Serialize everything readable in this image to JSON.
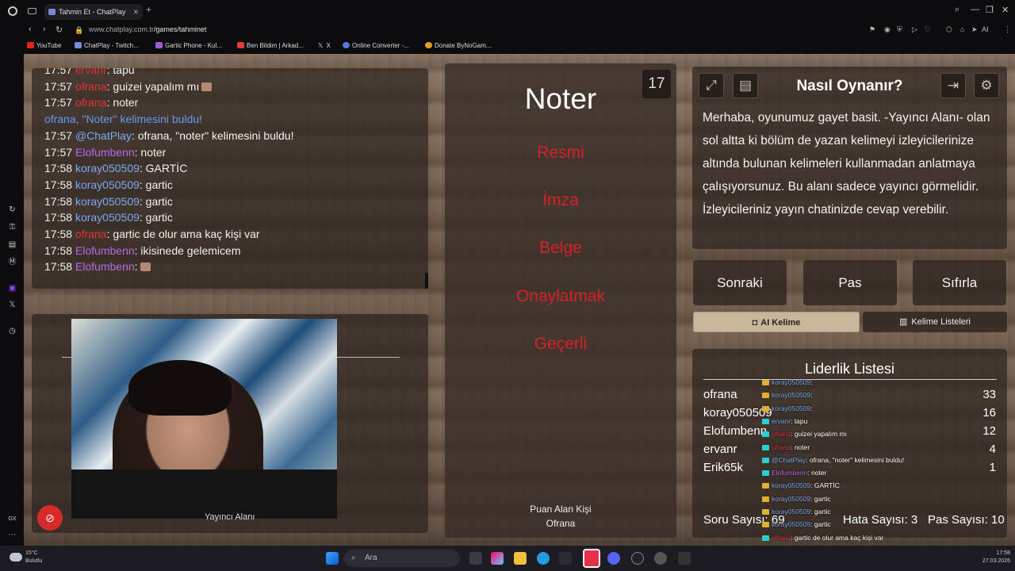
{
  "browser": {
    "tab_title": "Tahmin Et - ChatPlay",
    "url_host": "www.chatplay.com.tr",
    "url_path": "/games/tahminet",
    "bookmarks": [
      "YouTube",
      "ChatPlay - Twitch...",
      "Gartic Phone - Kul...",
      "Ben Bildim | Arkad...",
      "X",
      "Online Converter -...",
      "Donate ByNoGam..."
    ],
    "ai_label": "AI"
  },
  "chat": {
    "lines": [
      {
        "time": "17:57",
        "user": "ervanr",
        "color": "red",
        "text": ": tapu"
      },
      {
        "time": "17:57",
        "user": "ofrana",
        "color": "red",
        "text": ": guizei yapalım mı"
      },
      {
        "time": "17:57",
        "user": "ofrana",
        "color": "red",
        "text": ": noter"
      },
      {
        "time": "",
        "user": "ofrana, \"Noter\" kelimesini buldu!",
        "color": "sys",
        "text": ""
      },
      {
        "time": "17:57",
        "user": "@ChatPlay",
        "color": "blue",
        "text": ": ofrana, \"noter\" kelimesini buldu!"
      },
      {
        "time": "17:57",
        "user": "Elofumbenn",
        "color": "purple",
        "text": ": noter"
      },
      {
        "time": "17:58",
        "user": "koray050509",
        "color": "blue",
        "text": ": GARTİC"
      },
      {
        "time": "17:58",
        "user": "koray050509",
        "color": "blue",
        "text": ": gartic"
      },
      {
        "time": "17:58",
        "user": "koray050509",
        "color": "blue",
        "text": ": gartic"
      },
      {
        "time": "17:58",
        "user": "koray050509",
        "color": "blue",
        "text": ": gartic"
      },
      {
        "time": "17:58",
        "user": "ofrana",
        "color": "red",
        "text": ": gartic de olur ama kaç kişi var"
      },
      {
        "time": "17:58",
        "user": "Elofumbenn",
        "color": "purple",
        "text": ": ikisinede gelemicem"
      },
      {
        "time": "17:58",
        "user": "Elofumbenn",
        "color": "purple",
        "text": ":"
      }
    ]
  },
  "streamer": {
    "label": "Yayıncı Alanı"
  },
  "game": {
    "word": "Noter",
    "timer": "17",
    "forbidden": [
      "Resmi",
      "İmza",
      "Belge",
      "Onaylatmak",
      "Geçerli"
    ],
    "scorer_label": "Puan Alan Kişi",
    "scorer_name": "Ofrana"
  },
  "howto": {
    "title": "Nasıl Oynanır?",
    "text": "Merhaba, oyunumuz gayet basit. -Yayıncı Alanı- olan sol altta ki bölüm de yazan kelimeyi izleyicilerinize altında bulunan kelimeleri kullanmadan anlatmaya çalışıyorsunuz. Bu alanı sadece yayıncı görmelidir. İzleyicileriniz yayın chatinizde cevap verebilir."
  },
  "actions": {
    "next": "Sonraki",
    "pass": "Pas",
    "reset": "Sıfırla",
    "ai_word": "AI Kelime",
    "word_lists": "Kelime Listeleri"
  },
  "leaderboard": {
    "title": "Liderlik Listesi",
    "rows": [
      {
        "name": "ofrana",
        "score": "33"
      },
      {
        "name": "koray050509",
        "score": "16"
      },
      {
        "name": "Elofumbenn",
        "score": "12"
      },
      {
        "name": "ervanr",
        "score": "4"
      },
      {
        "name": "Erik65k",
        "score": "1"
      }
    ],
    "question_count": "Soru Sayısı: 69",
    "error_count": "Hata Sayısı: 3",
    "pass_count": "Pas Sayısı: 10"
  },
  "overlay_chat": [
    {
      "user": "koray050509",
      "text": ":"
    },
    {
      "user": "koray050509",
      "text": ":"
    },
    {
      "user": "koray050509",
      "text": ":"
    },
    {
      "user": "ervanr",
      "text": ": tapu"
    },
    {
      "user": "ofrana",
      "text": ": guizei yapalım mı"
    },
    {
      "user": "ofrana",
      "text": ": noter"
    },
    {
      "user": "@ChatPlay",
      "text": ": ofrana, \"noter\" kelimesini buldu!"
    },
    {
      "user": "Elofumbenn",
      "text": ": noter"
    },
    {
      "user": "koray050509",
      "text": ": GARTİC"
    },
    {
      "user": "koray050509",
      "text": ": gartic"
    },
    {
      "user": "koray050509",
      "text": ": gartic"
    },
    {
      "user": "koray050509",
      "text": ": gartic"
    },
    {
      "user": "ofrana",
      "text": ": gartic de olur ama kaç kişi var"
    },
    {
      "user": "Elofumbenn",
      "text": ": ikisinede gelemicem"
    },
    {
      "user": "Elofumbenn",
      "text": ":"
    }
  ],
  "taskbar": {
    "search_placeholder": "Ara",
    "weather_temp": "15°C",
    "weather_desc": "Bulutlu",
    "time": "17:58",
    "date": "27.03.2026"
  },
  "colors": {
    "forbidden": "#d8202a",
    "user_red": "#e1323a",
    "user_blue": "#7aa7f0",
    "user_purple": "#b46ae6",
    "ai_button": "#c9b79b"
  }
}
